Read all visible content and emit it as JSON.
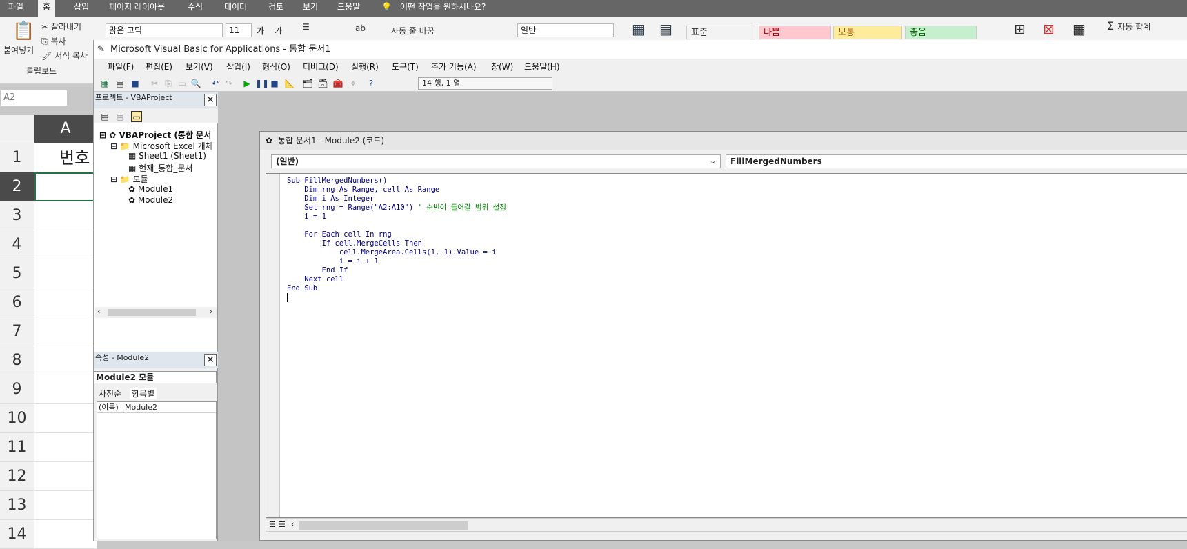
{
  "excel": {
    "tabs": [
      "파일",
      "홈",
      "삽입",
      "페이지 레이아웃",
      "수식",
      "데이터",
      "검토",
      "보기",
      "도움말"
    ],
    "tell_me": "어떤 작업을 원하시나요?",
    "clipboard": {
      "paste": "붙여넣기",
      "cut": "잘라내기",
      "copy": "복사",
      "format_painter": "서식 복사",
      "group": "클립보드"
    },
    "font_name": "맑은 고딕",
    "font_size": "11",
    "wrap_text": "자동 줄 바꿈",
    "number_format": "일반",
    "styles": [
      {
        "label": "표준",
        "bg": "#ffffff",
        "fg": "#000000"
      },
      {
        "label": "나쁨",
        "bg": "#ffc7ce",
        "fg": "#9c0006"
      },
      {
        "label": "보통",
        "bg": "#ffeb9c",
        "fg": "#9c5700"
      },
      {
        "label": "좋음",
        "bg": "#c6efce",
        "fg": "#006100"
      }
    ],
    "autosum": "자동 합계",
    "name_box": "A2",
    "column_header": "A",
    "cell_a1": "번호",
    "row_numbers": [
      "1",
      "2",
      "3",
      "4",
      "5",
      "6",
      "7",
      "8",
      "9",
      "10",
      "11",
      "12",
      "13",
      "14"
    ]
  },
  "vbe": {
    "title": "Microsoft Visual Basic for Applications - 통합 문서1",
    "menu": [
      "파일(F)",
      "편집(E)",
      "보기(V)",
      "삽입(I)",
      "형식(O)",
      "디버그(D)",
      "실행(R)",
      "도구(T)",
      "추가 기능(A)",
      "창(W)",
      "도움말(H)"
    ],
    "cursor_pos": "14 행, 1 열",
    "project": {
      "title": "프로젝트 - VBAProject",
      "root": "VBAProject (통합 문서",
      "excel_objects": "Microsoft Excel 개체",
      "sheet1": "Sheet1 (Sheet1)",
      "workbook": "현재_통합_문서",
      "modules_folder": "모듈",
      "module1": "Module1",
      "module2": "Module2"
    },
    "properties": {
      "title": "속성 - Module2",
      "object": "Module2 모듈",
      "tab_alpha": "사전순",
      "tab_cat": "항목별",
      "name_key": "(이름)",
      "name_value": "Module2"
    },
    "code_window": {
      "title": "통합 문서1 - Module2 (코드)",
      "object_combo": "(일반)",
      "proc_combo": "FillMergedNumbers",
      "lines": [
        {
          "code": "Sub FillMergedNumbers()",
          "comment": ""
        },
        {
          "code": "    Dim rng As Range, cell As Range",
          "comment": ""
        },
        {
          "code": "    Dim i As Integer",
          "comment": ""
        },
        {
          "code": "    Set rng = Range(\"A2:A10\") ",
          "comment": "' 순번이 들어갈 범위 설정"
        },
        {
          "code": "    i = 1",
          "comment": ""
        },
        {
          "code": "",
          "comment": ""
        },
        {
          "code": "    For Each cell In rng",
          "comment": ""
        },
        {
          "code": "        If cell.MergeCells Then",
          "comment": ""
        },
        {
          "code": "            cell.MergeArea.Cells(1, 1).Value = i",
          "comment": ""
        },
        {
          "code": "            i = i + 1",
          "comment": ""
        },
        {
          "code": "        End If",
          "comment": ""
        },
        {
          "code": "    Next cell",
          "comment": ""
        },
        {
          "code": "End Sub",
          "comment": ""
        },
        {
          "code": "",
          "comment": ""
        }
      ]
    }
  }
}
